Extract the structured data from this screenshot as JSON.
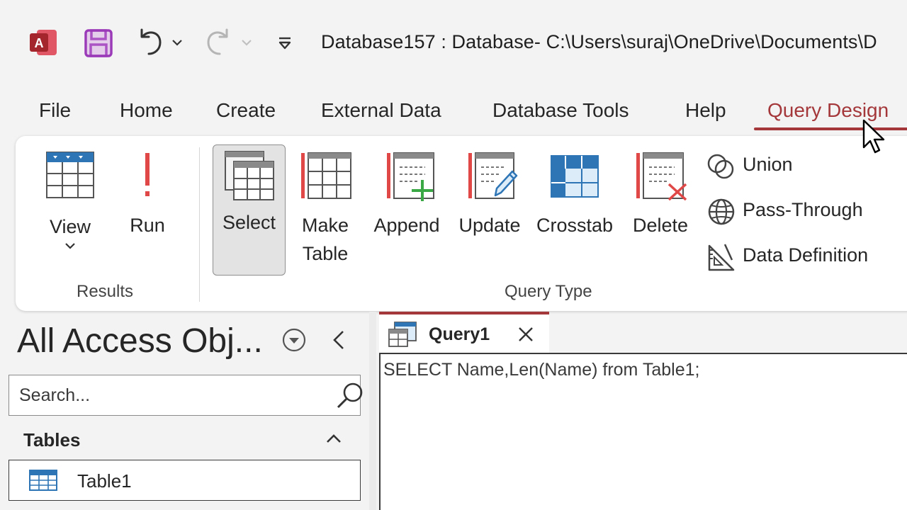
{
  "window": {
    "title": "Database157 : Database- C:\\Users\\suraj\\OneDrive\\Documents\\D"
  },
  "app_logo": {
    "letter": "A",
    "color": "#c4314b"
  },
  "quick_access": [
    "save-icon",
    "undo-icon",
    "redo-icon",
    "customize-icon"
  ],
  "tabs": [
    {
      "label": "File"
    },
    {
      "label": "Home"
    },
    {
      "label": "Create"
    },
    {
      "label": "External Data"
    },
    {
      "label": "Database Tools"
    },
    {
      "label": "Help"
    },
    {
      "label": "Query Design",
      "active": true
    }
  ],
  "ribbon": {
    "results": {
      "label": "Results",
      "view": "View",
      "run": "Run"
    },
    "query_type": {
      "label": "Query Type",
      "select": "Select",
      "make_table_line1": "Make",
      "make_table_line2": "Table",
      "append": "Append",
      "update": "Update",
      "crosstab": "Crosstab",
      "delete": "Delete",
      "union": "Union",
      "pass_through": "Pass-Through",
      "data_definition": "Data Definition"
    }
  },
  "nav_pane": {
    "title": "All Access Obj...",
    "search_placeholder": "Search...",
    "groups": [
      {
        "label": "Tables",
        "items": [
          {
            "label": "Table1"
          }
        ]
      }
    ]
  },
  "document": {
    "tab_label": "Query1",
    "sql": "SELECT Name,Len(Name) from Table1;"
  },
  "colors": {
    "accent": "#a4373a",
    "ribbon_bg": "#ffffff",
    "app_bg": "#f3f3f3",
    "select_bg": "#e3e3e3"
  }
}
